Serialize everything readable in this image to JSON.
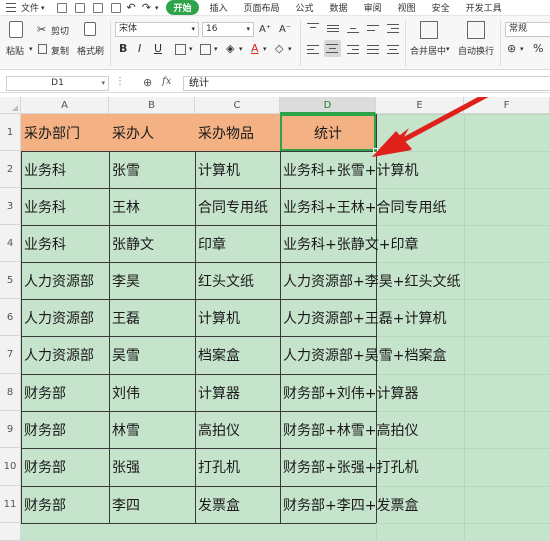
{
  "menubar": {
    "file_label": "文件",
    "tabs": [
      "开始",
      "插入",
      "页面布局",
      "公式",
      "数据",
      "审阅",
      "视图",
      "安全",
      "开发工具"
    ]
  },
  "ribbon": {
    "cut": "剪切",
    "paste": "粘贴",
    "copy": "复制",
    "format_painter": "格式刷",
    "font_name": "宋体",
    "font_size": "16",
    "merge_center": "合并居中",
    "wrap_text": "自动换行",
    "number_format": "常规",
    "bold": "B",
    "italic": "I",
    "underline": "U",
    "percent": "%",
    "font_color_glyph": "A",
    "highlight_glyph": "A"
  },
  "formula_bar": {
    "cell_ref": "D1",
    "fx": "fx",
    "content": "统计"
  },
  "columns": [
    "A",
    "B",
    "C",
    "D",
    "E",
    "F"
  ],
  "rows": [
    "1",
    "2",
    "3",
    "4",
    "5",
    "6",
    "7",
    "8",
    "9",
    "10",
    "11"
  ],
  "table": {
    "headers": [
      "采办部门",
      "采办人",
      "采办物品",
      "统计"
    ],
    "rows": [
      [
        "业务科",
        "张雪",
        "计算机",
        "业务科+张雪+计算机"
      ],
      [
        "业务科",
        "王林",
        "合同专用纸",
        "业务科+王林+合同专用纸"
      ],
      [
        "业务科",
        "张静文",
        "印章",
        "业务科+张静文+印章"
      ],
      [
        "人力资源部",
        "李昊",
        "红头文纸",
        "人力资源部+李昊+红头文纸"
      ],
      [
        "人力资源部",
        "王磊",
        "计算机",
        "人力资源部+王磊+计算机"
      ],
      [
        "人力资源部",
        "吴雪",
        "档案盒",
        "人力资源部+吴雪+档案盒"
      ],
      [
        "财务部",
        "刘伟",
        "计算器",
        "财务部+刘伟+计算器"
      ],
      [
        "财务部",
        "林雪",
        "高拍仪",
        "财务部+林雪+高拍仪"
      ],
      [
        "财务部",
        "张强",
        "打孔机",
        "财务部+张强+打孔机"
      ],
      [
        "财务部",
        "李四",
        "发票盒",
        "财务部+李四+发票盒"
      ]
    ]
  },
  "colors": {
    "header_fill": "#f4b183",
    "body_fill": "#c6e3cc",
    "selection_green": "#2fa34a",
    "arrow_red": "#e0201b"
  }
}
